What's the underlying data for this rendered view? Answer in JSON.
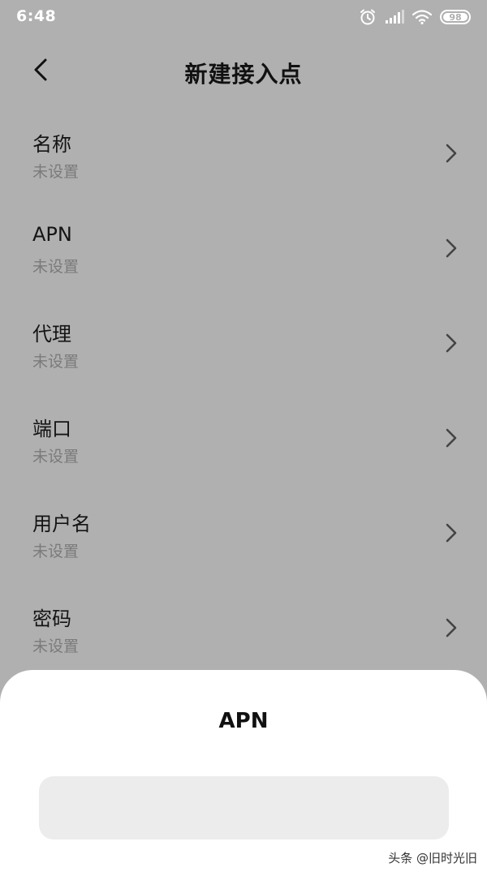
{
  "status_bar": {
    "time": "6:48",
    "battery": "98",
    "icons": [
      "alarm-icon",
      "signal-icon",
      "wifi-icon",
      "battery-icon"
    ]
  },
  "header": {
    "back_icon": "chevron-left-icon",
    "title": "新建接入点"
  },
  "items": [
    {
      "title": "名称",
      "subtitle": "未设置"
    },
    {
      "title": "APN",
      "subtitle": "未设置"
    },
    {
      "title": "代理",
      "subtitle": "未设置"
    },
    {
      "title": "端口",
      "subtitle": "未设置"
    },
    {
      "title": "用户名",
      "subtitle": "未设置"
    },
    {
      "title": "密码",
      "subtitle": "未设置"
    }
  ],
  "sheet": {
    "title": "APN",
    "input_value": "",
    "input_placeholder": ""
  },
  "watermark": "头条 @旧时光旧",
  "colors": {
    "dim_background": "#b0b0b0",
    "sheet_background": "#ffffff",
    "input_background": "#ececec",
    "subtitle": "#7a7a7a"
  }
}
